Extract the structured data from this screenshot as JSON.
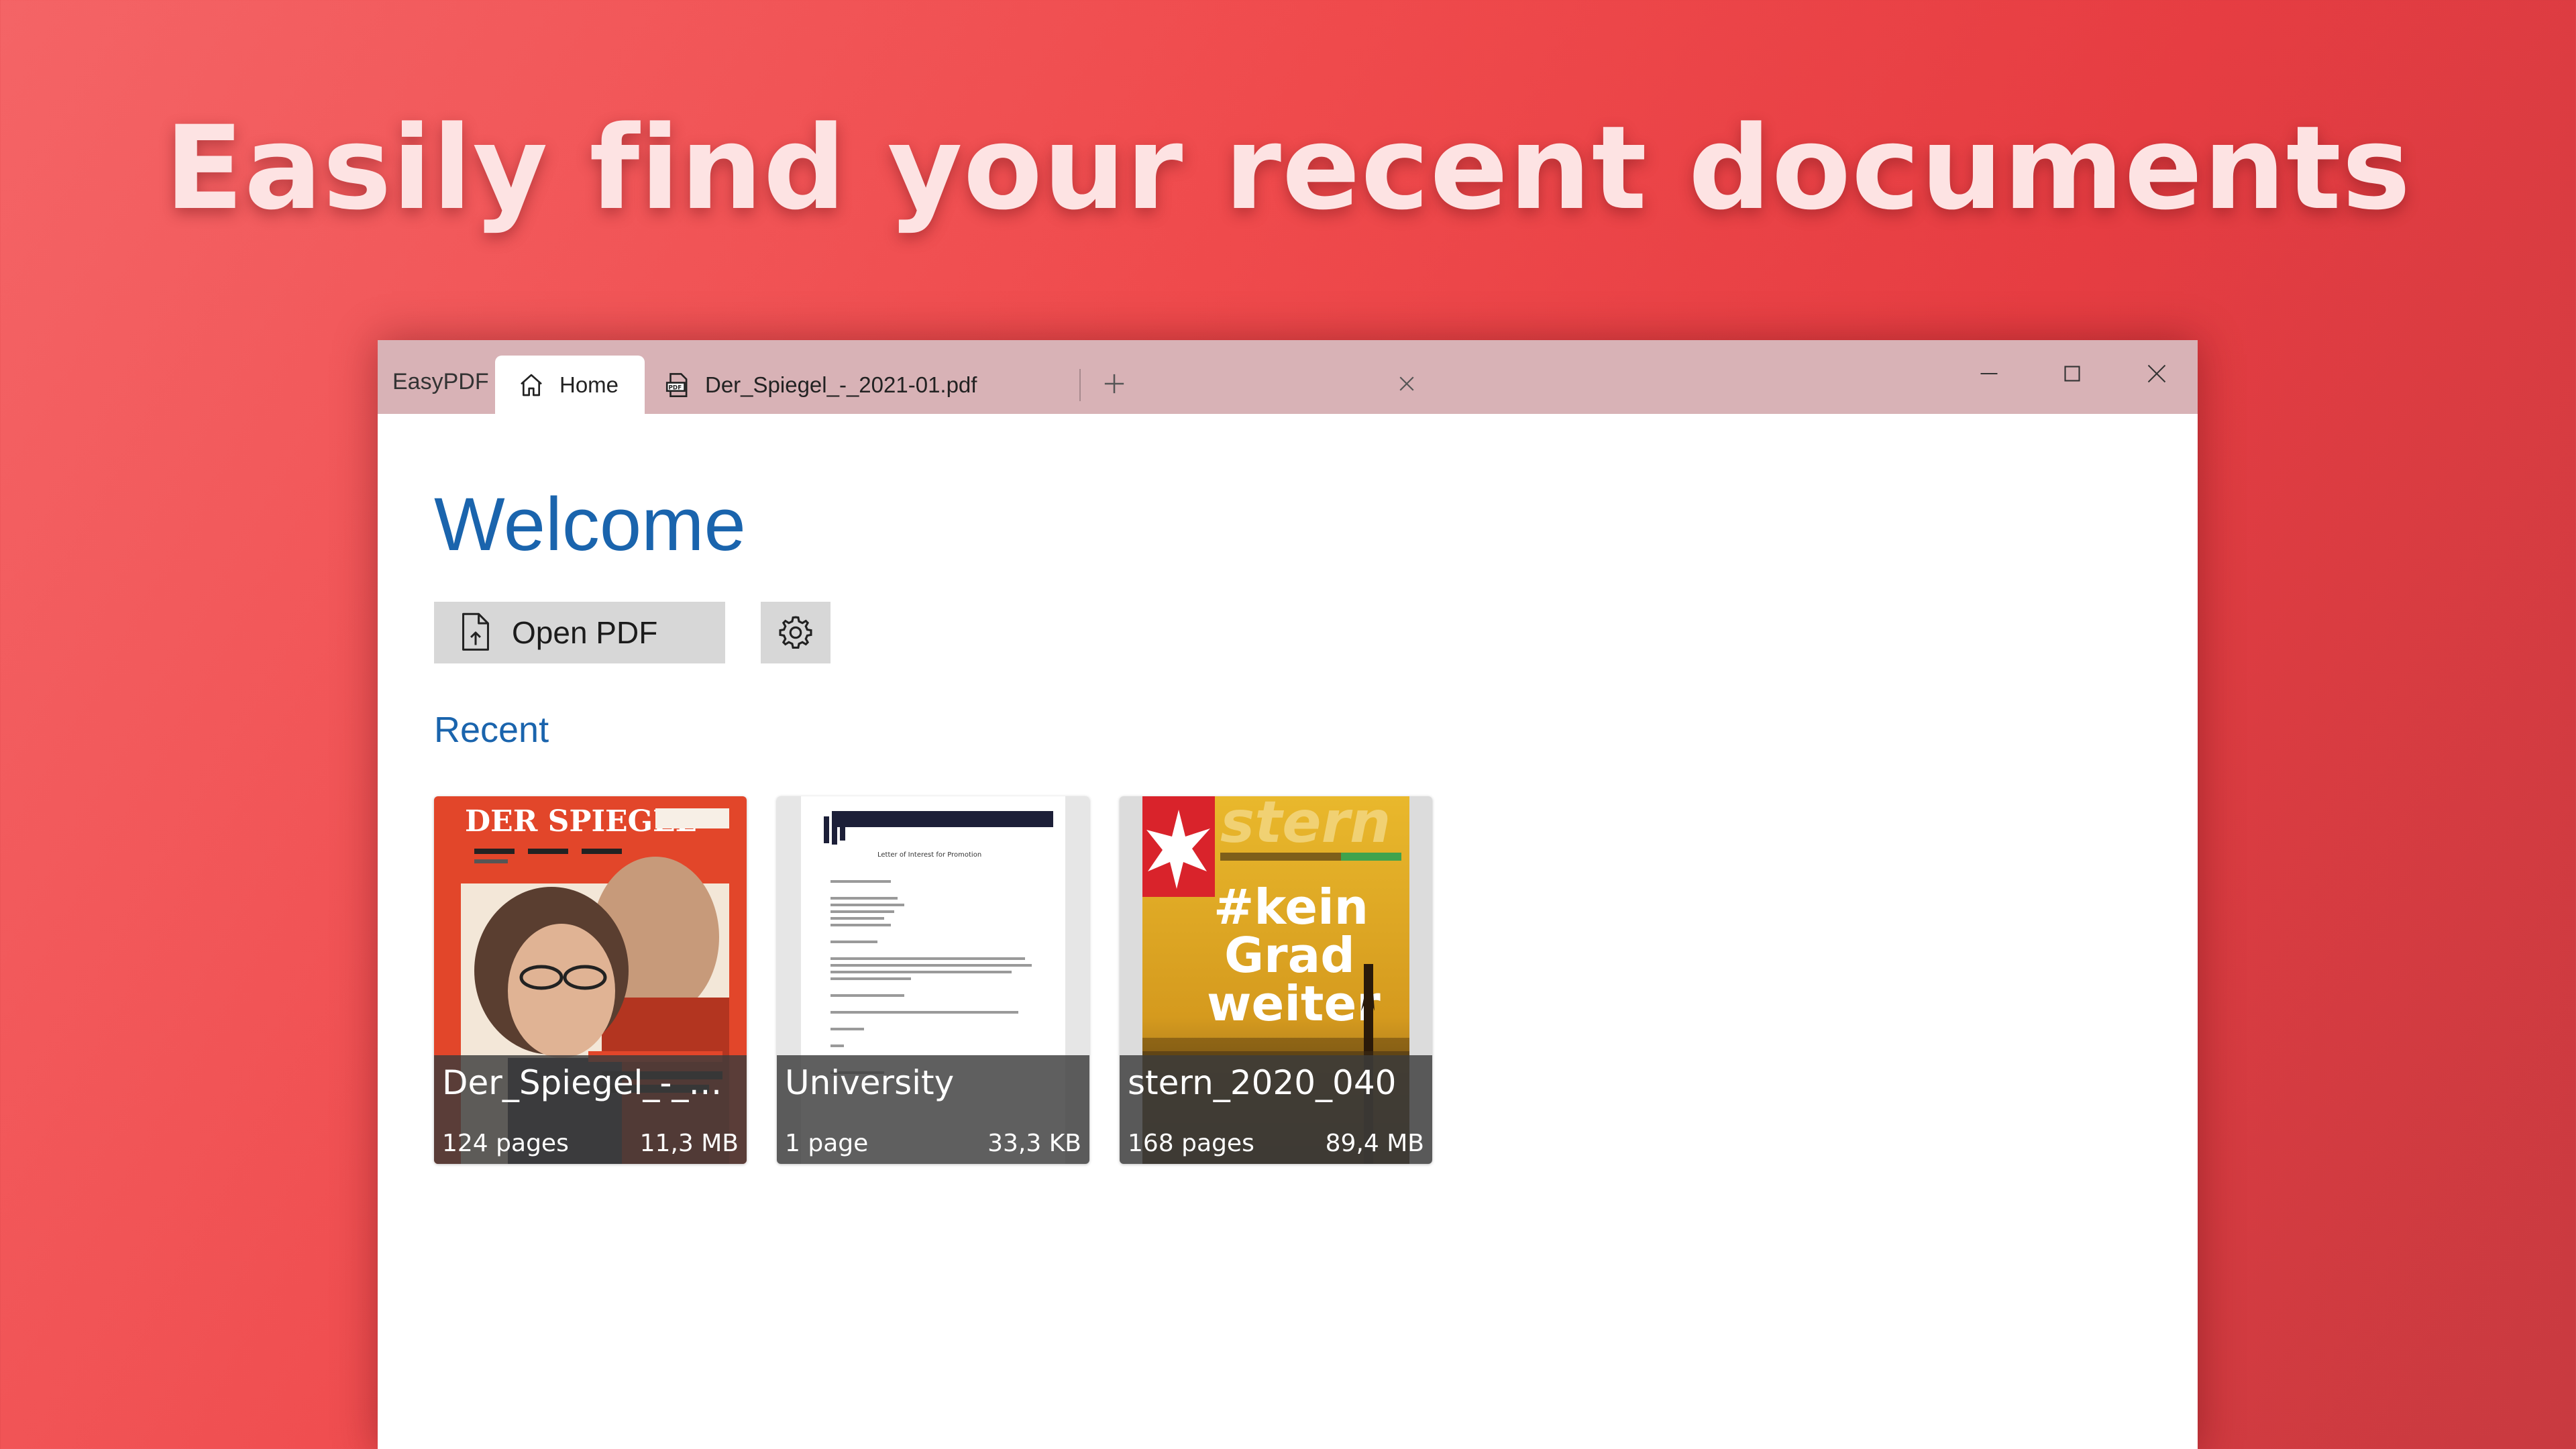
{
  "headline": "Easily find your recent documents",
  "window": {
    "app_title": "EasyPDF",
    "tabs": [
      {
        "label": "Home",
        "icon": "home-icon",
        "active": true
      },
      {
        "label": "Der_Spiegel_-_2021-01.pdf",
        "icon": "pdf-file-icon",
        "active": false
      }
    ],
    "new_tab_icon": "plus-icon",
    "controls": [
      "minimize-icon",
      "maximize-icon",
      "close-icon"
    ]
  },
  "home": {
    "title": "Welcome",
    "open_button_label": "Open PDF",
    "settings_icon": "gear-icon",
    "recent_label": "Recent",
    "recent": [
      {
        "name": "Der_Spiegel_-_2...",
        "pages": "124 pages",
        "size": "11,3 MB"
      },
      {
        "name": "University",
        "pages": "1 page",
        "size": "33,3 KB"
      },
      {
        "name": "stern_2020_040",
        "pages": "168 pages",
        "size": "89,4 MB"
      }
    ],
    "thumbnails": {
      "spiegel_masthead": "DER SPIEGEL",
      "letter_title": "Letter of Interest for Promotion",
      "stern_masthead": "stern",
      "stern_headline": [
        "#kein",
        "Grad",
        "weiter"
      ]
    }
  },
  "colors": {
    "background": "#ef4a4c",
    "titlebar": "#d8b2b6",
    "accent_blue": "#1a64ad",
    "button_gray": "#d7d7d7"
  }
}
